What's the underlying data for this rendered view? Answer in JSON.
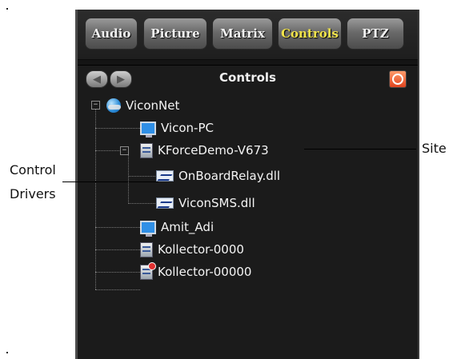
{
  "tabs": [
    {
      "label": "Audio",
      "active": false
    },
    {
      "label": "Picture",
      "active": false
    },
    {
      "label": "Matrix",
      "active": false
    },
    {
      "label": "Controls",
      "active": true
    },
    {
      "label": "PTZ",
      "active": false
    }
  ],
  "header": {
    "title": "Controls"
  },
  "tree": {
    "root": {
      "label": "ViconNet",
      "expanded": true,
      "icon": "globe-icon"
    },
    "nodes": [
      {
        "label": "Vicon-PC",
        "icon": "monitor-icon"
      },
      {
        "label": "KForceDemo-V673",
        "icon": "server-icon",
        "expanded": true
      },
      {
        "label": "OnBoardRelay.dll",
        "icon": "driver-icon"
      },
      {
        "label": "ViconSMS.dll",
        "icon": "driver-icon"
      },
      {
        "label": "Amit_Adi",
        "icon": "monitor-icon"
      },
      {
        "label": "Kollector-0000",
        "icon": "server-icon"
      },
      {
        "label": "Kollector-00000",
        "icon": "server-error-icon"
      }
    ]
  },
  "annotations": {
    "site": "Site",
    "control_drivers_line1": "Control",
    "control_drivers_line2": "Drivers"
  },
  "colors": {
    "panel_bg": "#1b1b1b",
    "active_tab_text": "#f1e34a",
    "tab_text": "#f2f2f2"
  }
}
